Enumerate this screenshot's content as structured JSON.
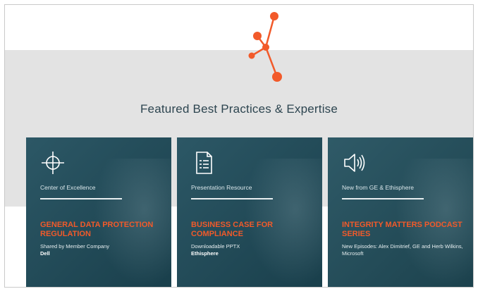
{
  "brand": {
    "accent": "#f25a2a",
    "card_bg": "#1f4d5c",
    "band_bg": "#e3e3e3"
  },
  "section": {
    "heading": "Featured Best Practices & Expertise"
  },
  "cards": [
    {
      "icon": "crosshair-icon",
      "label": "Center of Excellence",
      "title": "GENERAL DATA PROTECTION REGULATION",
      "desc_line": "Shared by Member Company",
      "desc_strong": "Dell"
    },
    {
      "icon": "document-icon",
      "label": "Presentation Resource",
      "title": "BUSINESS CASE FOR COMPLIANCE",
      "desc_line": "Downloadable PPTX",
      "desc_strong": "Ethisphere"
    },
    {
      "icon": "speaker-icon",
      "label": "New from GE & Ethisphere",
      "title": "INTEGRITY MATTERS PODCAST SERIES",
      "desc_line": "New Episodes: Alex Dimitrief, GE and Herb Wilkins, Microsoft",
      "desc_strong": ""
    }
  ]
}
